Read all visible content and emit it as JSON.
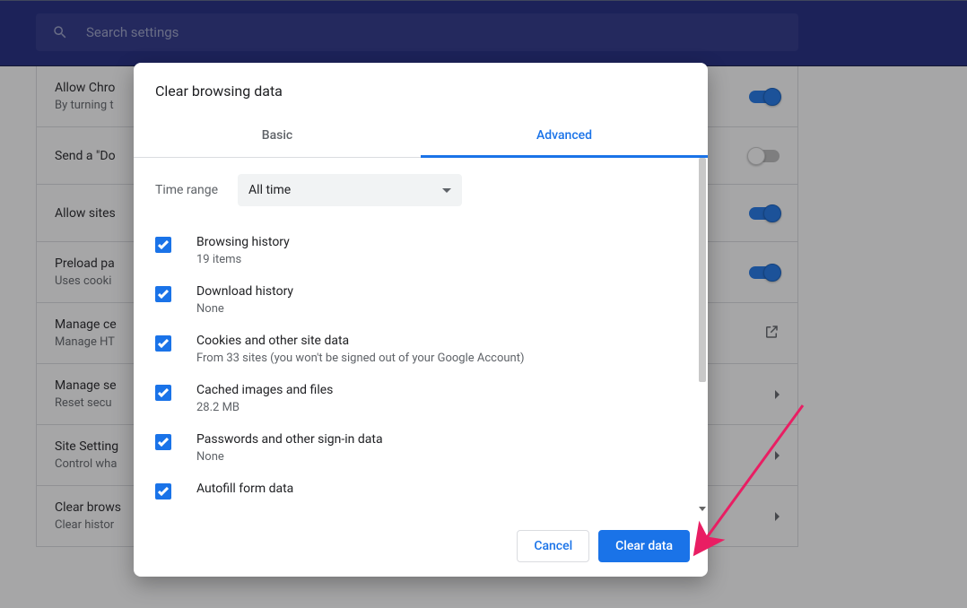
{
  "search": {
    "placeholder": "Search settings"
  },
  "settings_rows": [
    {
      "title": "Allow Chro",
      "subtitle": "By turning t",
      "control": "toggle-on"
    },
    {
      "title": "Send a \"Do",
      "subtitle": "",
      "control": "toggle-off"
    },
    {
      "title": "Allow sites",
      "subtitle": "",
      "control": "toggle-on"
    },
    {
      "title": "Preload pa",
      "subtitle": "Uses cooki",
      "control": "toggle-on"
    },
    {
      "title": "Manage ce",
      "subtitle": "Manage HT",
      "control": "launch"
    },
    {
      "title": "Manage se",
      "subtitle": "Reset secu",
      "control": "chevron"
    },
    {
      "title": "Site Setting",
      "subtitle": "Control wha",
      "control": "chevron"
    },
    {
      "title": "Clear brows",
      "subtitle": "Clear histor",
      "control": "chevron"
    }
  ],
  "dialog": {
    "title": "Clear browsing data",
    "tabs": {
      "basic": "Basic",
      "advanced": "Advanced"
    },
    "time_range_label": "Time range",
    "time_range_value": "All time",
    "items": [
      {
        "title": "Browsing history",
        "subtitle": "19 items",
        "checked": true
      },
      {
        "title": "Download history",
        "subtitle": "None",
        "checked": true
      },
      {
        "title": "Cookies and other site data",
        "subtitle": "From 33 sites (you won't be signed out of your Google Account)",
        "checked": true
      },
      {
        "title": "Cached images and files",
        "subtitle": "28.2 MB",
        "checked": true
      },
      {
        "title": "Passwords and other sign-in data",
        "subtitle": "None",
        "checked": true
      },
      {
        "title": "Autofill form data",
        "subtitle": "",
        "checked": true
      }
    ],
    "cancel": "Cancel",
    "confirm": "Clear data"
  }
}
